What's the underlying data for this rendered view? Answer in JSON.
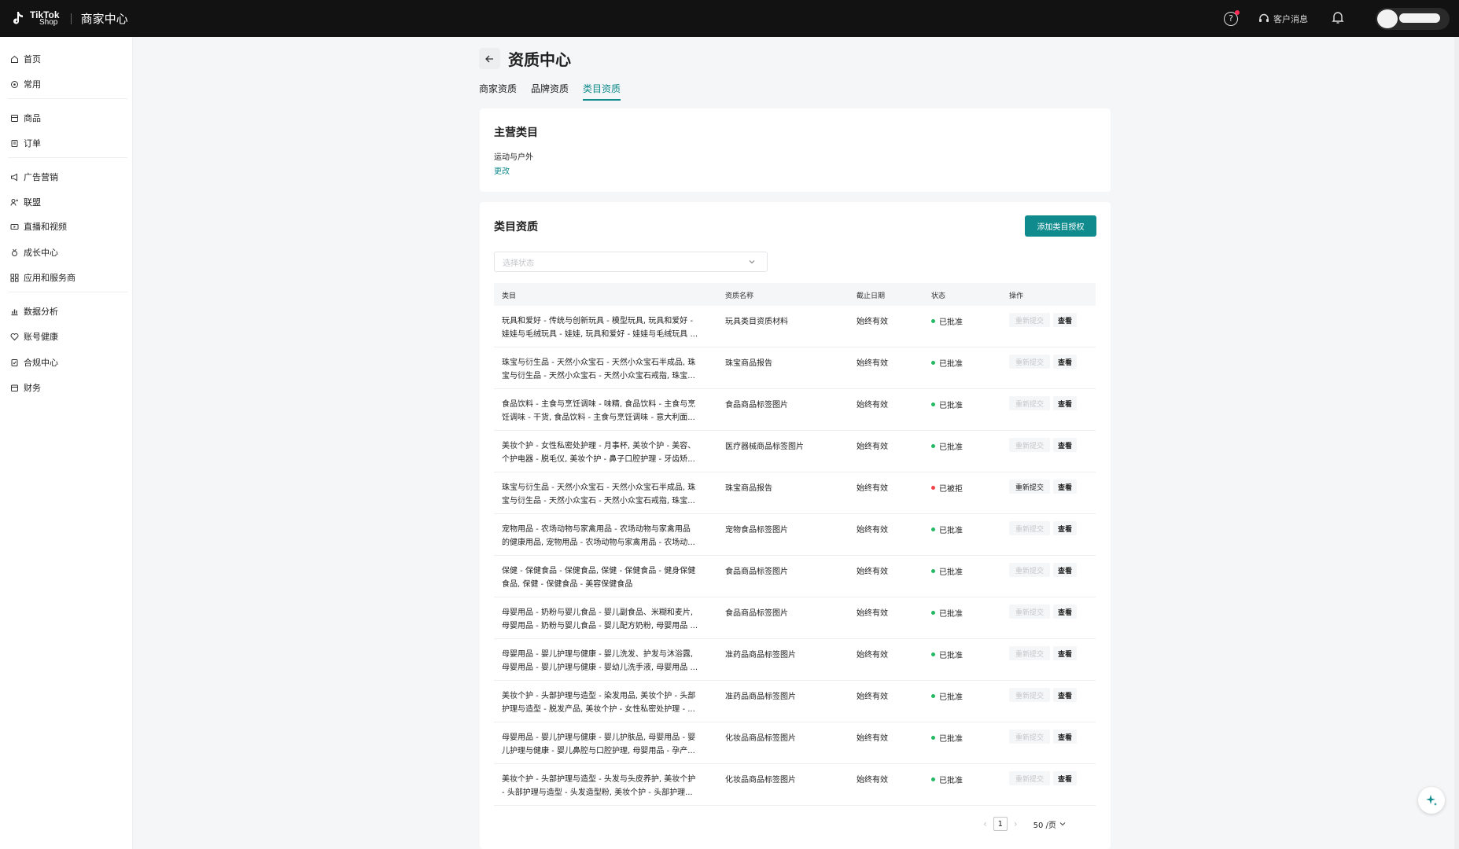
{
  "topbar": {
    "logo_line1": "TikTok",
    "logo_line2": "Shop",
    "title": "商家中心",
    "customer_msg": "客户消息"
  },
  "sidebar": {
    "items": [
      {
        "label": "首页",
        "icon": "home-icon"
      },
      {
        "label": "常用",
        "icon": "star-icon"
      },
      {
        "label": "商品",
        "icon": "product-icon"
      },
      {
        "label": "订单",
        "icon": "order-icon"
      },
      {
        "label": "广告营销",
        "icon": "megaphone-icon"
      },
      {
        "label": "联盟",
        "icon": "affiliate-icon"
      },
      {
        "label": "直播和视频",
        "icon": "video-icon"
      },
      {
        "label": "成长中心",
        "icon": "medal-icon"
      },
      {
        "label": "应用和服务商",
        "icon": "apps-icon"
      },
      {
        "label": "数据分析",
        "icon": "chart-icon"
      },
      {
        "label": "账号健康",
        "icon": "health-icon"
      },
      {
        "label": "合规中心",
        "icon": "compliance-icon"
      },
      {
        "label": "财务",
        "icon": "finance-icon"
      }
    ]
  },
  "page": {
    "title": "资质中心",
    "tabs": [
      "商家资质",
      "品牌资质",
      "类目资质"
    ],
    "active_tab": "类目资质"
  },
  "main_category": {
    "heading": "主营类目",
    "value": "运动与户外",
    "edit_label": "更改"
  },
  "qualifications": {
    "heading": "类目资质",
    "add_button": "添加类目授权",
    "filter_placeholder": "选择状态",
    "columns": [
      "类目",
      "资质名称",
      "截止日期",
      "状态",
      "操作"
    ],
    "resubmit_label": "重新提交",
    "view_label": "查看",
    "rows": [
      {
        "cat1": "玩具和爱好 - 传统与创新玩具 - 模型玩具, 玩具和爱好 -",
        "cat2": "娃娃与毛绒玩具 - 娃娃, 玩具和爱好 - 娃娃与毛绒玩具 ...",
        "name": "玩具类目资质材料",
        "date": "始终有效",
        "status": "已批准",
        "status_color": "#25b864",
        "resubmit_enabled": false
      },
      {
        "cat1": "珠宝与衍生品 - 天然小众宝石 - 天然小众宝石半成品, 珠",
        "cat2": "宝与衍生品 - 天然小众宝石 - 天然小众宝石戒指, 珠宝...",
        "name": "珠宝商品报告",
        "date": "始终有效",
        "status": "已批准",
        "status_color": "#25b864",
        "resubmit_enabled": false
      },
      {
        "cat1": "食品饮料 - 主食与烹饪调味 - 味精, 食品饮料 - 主食与烹",
        "cat2": "饪调味 - 干货, 食品饮料 - 主食与烹饪调味 - 意大利面...",
        "name": "食品商品标签图片",
        "date": "始终有效",
        "status": "已批准",
        "status_color": "#25b864",
        "resubmit_enabled": false
      },
      {
        "cat1": "美妆个护 - 女性私密处护理 - 月事杯, 美妆个护 - 美容、",
        "cat2": "个护电器 - 脱毛仪, 美妆个护 - 鼻子口腔护理 - 牙齿矫...",
        "name": "医疗器械商品标签图片",
        "date": "始终有效",
        "status": "已批准",
        "status_color": "#25b864",
        "resubmit_enabled": false
      },
      {
        "cat1": "珠宝与衍生品 - 天然小众宝石 - 天然小众宝石半成品, 珠",
        "cat2": "宝与衍生品 - 天然小众宝石 - 天然小众宝石戒指, 珠宝...",
        "name": "珠宝商品报告",
        "date": "始终有效",
        "status": "已被拒",
        "status_color": "#f5434a",
        "resubmit_enabled": true
      },
      {
        "cat1": "宠物用品 - 农场动物与家禽用品 - 农场动物与家禽用品",
        "cat2": "的健康用品, 宠物用品 - 农场动物与家禽用品 - 农场动...",
        "name": "宠物食品标签图片",
        "date": "始终有效",
        "status": "已批准",
        "status_color": "#25b864",
        "resubmit_enabled": false
      },
      {
        "cat1": "保健 - 保健食品 - 保健食品, 保健 - 保健食品 - 健身保健",
        "cat2": "食品, 保健 - 保健食品 - 美容保健食品",
        "name": "食品商品标签图片",
        "date": "始终有效",
        "status": "已批准",
        "status_color": "#25b864",
        "resubmit_enabled": false
      },
      {
        "cat1": "母婴用品 - 奶粉与婴儿食品 - 婴儿副食品、米糊和麦片,",
        "cat2": "母婴用品 - 奶粉与婴儿食品 - 婴儿配方奶粉, 母婴用品 ...",
        "name": "食品商品标签图片",
        "date": "始终有效",
        "status": "已批准",
        "status_color": "#25b864",
        "resubmit_enabled": false
      },
      {
        "cat1": "母婴用品 - 婴儿护理与健康 - 婴儿洗发、护发与沐浴露,",
        "cat2": "母婴用品 - 婴儿护理与健康 - 婴幼儿洗手液, 母婴用品 ...",
        "name": "准药品商品标签图片",
        "date": "始终有效",
        "status": "已批准",
        "status_color": "#25b864",
        "resubmit_enabled": false
      },
      {
        "cat1": "美妆个护 - 头部护理与造型 - 染发用品, 美妆个护 - 头部",
        "cat2": "护理与造型 - 脱发产品, 美妆个护 - 女性私密处护理 - ...",
        "name": "准药品商品标签图片",
        "date": "始终有效",
        "status": "已批准",
        "status_color": "#25b864",
        "resubmit_enabled": false
      },
      {
        "cat1": "母婴用品 - 婴儿护理与健康 - 婴儿护肤品, 母婴用品 - 婴",
        "cat2": "儿护理与健康 - 婴儿鼻腔与口腔护理, 母婴用品 - 孕产...",
        "name": "化妆品商品标签图片",
        "date": "始终有效",
        "status": "已批准",
        "status_color": "#25b864",
        "resubmit_enabled": false
      },
      {
        "cat1": "美妆个护 - 头部护理与造型 - 头发与头皮养护, 美妆个护",
        "cat2": "- 头部护理与造型 - 头发造型粉, 美妆个护 - 头部护理...",
        "name": "化妆品商品标签图片",
        "date": "始终有效",
        "status": "已批准",
        "status_color": "#25b864",
        "resubmit_enabled": false
      }
    ]
  },
  "pagination": {
    "current_page": "1",
    "page_size": "50 /页"
  },
  "colors": {
    "accent": "#0f8b8d",
    "approved": "#25b864",
    "rejected": "#f5434a",
    "topbar": "#121212"
  }
}
